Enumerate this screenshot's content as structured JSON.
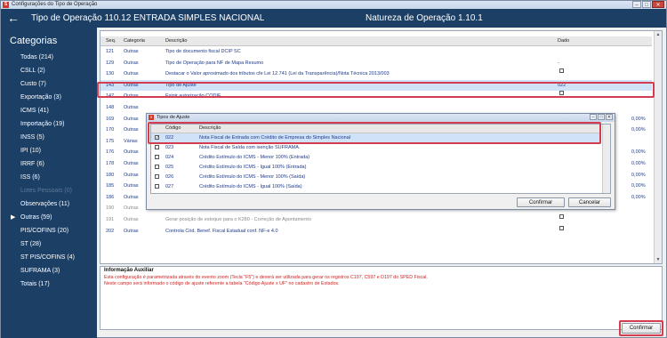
{
  "window": {
    "title": "Configurações do Tipo de Operação",
    "app_icon": "S"
  },
  "header": {
    "back_icon": "←",
    "operation": "Tipo de Operação 110.12  ENTRADA SIMPLES NACIONAL",
    "nature": "Natureza de Operação 1.10.1"
  },
  "sidebar": {
    "title": "Categorias",
    "items": [
      {
        "label": "Todas (214)"
      },
      {
        "label": "CSLL (2)"
      },
      {
        "label": "Custo (7)"
      },
      {
        "label": "Exportação (3)"
      },
      {
        "label": "ICMS (41)"
      },
      {
        "label": "Importação (19)"
      },
      {
        "label": "INSS (5)"
      },
      {
        "label": "IPI (10)"
      },
      {
        "label": "IRRF (6)"
      },
      {
        "label": "ISS (6)"
      },
      {
        "label": "Lotes Pessoais (0)"
      },
      {
        "label": "Observações (11)"
      },
      {
        "label": "Outras (59)"
      },
      {
        "label": "PIS/COFINS (20)"
      },
      {
        "label": "ST (28)"
      },
      {
        "label": "ST PIS/COFINS (4)"
      },
      {
        "label": "SUFRAMA (3)"
      },
      {
        "label": "Totais (17)"
      }
    ]
  },
  "table": {
    "headers": {
      "seq": "Seq.",
      "categoria": "Categoria",
      "descricao": "Descrição",
      "dado": "Dado"
    },
    "rows": [
      {
        "seq": "121",
        "cat": "Outras",
        "desc": "Tipo de documento fiscal DCIP SC",
        "dado": ""
      },
      {
        "seq": "129",
        "cat": "Outras",
        "desc": "Tipo de Operação para NF de Mapa Resumo",
        "dado": "-"
      },
      {
        "seq": "130",
        "cat": "Outras",
        "desc": "Destacar o Valor aproximado dos tributos cfe Lei 12.741 (Lei da Transparência)/Nota Técnica 2013/003",
        "dado": ""
      },
      {
        "seq": "143",
        "cat": "Outras",
        "desc": "Tipo de Ajuste",
        "dado": "022"
      },
      {
        "seq": "147",
        "cat": "Outras",
        "desc": "Exigir autorização CODIF",
        "dado": ""
      },
      {
        "seq": "148",
        "cat": "Outras",
        "desc": "",
        "dado": "",
        "extra": ""
      },
      {
        "seq": "169",
        "cat": "Outras",
        "desc": "",
        "dado": "",
        "extra": "0,00%"
      },
      {
        "seq": "170",
        "cat": "Outras",
        "desc": "",
        "dado": "",
        "extra": "0,00%"
      },
      {
        "seq": "175",
        "cat": "Várias",
        "desc": "",
        "dado": "",
        "extra": ""
      },
      {
        "seq": "176",
        "cat": "Outras",
        "desc": "",
        "dado": "",
        "extra": "0,00%"
      },
      {
        "seq": "178",
        "cat": "Outras",
        "desc": "",
        "dado": "",
        "extra": "0,00%"
      },
      {
        "seq": "180",
        "cat": "Outras",
        "desc": "",
        "dado": "",
        "extra": "0,00%"
      },
      {
        "seq": "185",
        "cat": "Outras",
        "desc": "Alíquota/Índice FACS",
        "dado": "",
        "extra": "0,00%"
      },
      {
        "seq": "186",
        "cat": "Outras",
        "desc": "Alíquota/Índice FETHAB",
        "dado": "",
        "extra": "0,00%"
      },
      {
        "seq": "190",
        "cat": "Outras",
        "desc": "Desconsiderar cálculo do DIFAL",
        "dado": ""
      },
      {
        "seq": "191",
        "cat": "Outras",
        "desc": "Gerar posição de estoque para o K280 - Correção de Apontamento",
        "dado": ""
      },
      {
        "seq": "202",
        "cat": "Outras",
        "desc": "Controla Cód. Benef. Fiscal Estadual conf. NF-e 4.0",
        "dado": ""
      }
    ]
  },
  "dialog": {
    "title": "Tipos de Ajuste",
    "headers": {
      "codigo": "Código",
      "descricao": "Descrição"
    },
    "rows": [
      {
        "codigo": "022",
        "desc": "Nota Fiscal de Entrada com Crédito de Empresa do Simples Nacional",
        "checked": true
      },
      {
        "codigo": "023",
        "desc": "Nota Fiscal de Saída com isenção SUFRAMA.",
        "checked": false
      },
      {
        "codigo": "024",
        "desc": "Crédito Estímulo do ICMS - Menor 100% (Entrada)",
        "checked": false
      },
      {
        "codigo": "025",
        "desc": "Crédito Estímulo do ICMS - Igual 100% (Entrada)",
        "checked": false
      },
      {
        "codigo": "026",
        "desc": "Crédito Estímulo do ICMS - Menor 100% (Saída)",
        "checked": false
      },
      {
        "codigo": "027",
        "desc": "Crédito Estímulo do ICMS - Igual 100% (Saída)",
        "checked": false
      }
    ],
    "confirm": "Confirmar",
    "cancel": "Cancelar"
  },
  "info": {
    "title": "Informação Auxiliar",
    "line1": "Esta configuração é parametrizada através do evento zoom (Tecla \"F5\") e deverá ser utilizada para gerar os registros C197, C597 e D197 do SPED Fiscal.",
    "line2": "Neste campo será informado o código de ajuste referente a tabela \"Código Ajuste x UF\" no cadastro de Estados."
  },
  "close_button": "Confirmar",
  "colors": {
    "header_bg": "#1c3f66",
    "highlight": "#d43c4f",
    "selection": "#cfe2f7",
    "info_text": "#d12020"
  }
}
